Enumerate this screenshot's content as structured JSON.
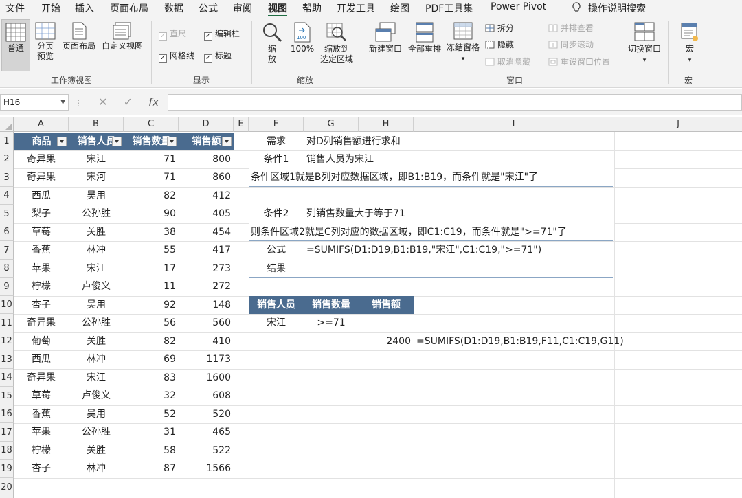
{
  "menu": [
    "文件",
    "开始",
    "插入",
    "页面布局",
    "数据",
    "公式",
    "审阅",
    "视图",
    "帮助",
    "开发工具",
    "绘图",
    "PDF工具集",
    "Power Pivot",
    "操作说明搜索"
  ],
  "ribbon": {
    "workbook_views": {
      "normal": "普通",
      "page_break_1": "分页",
      "page_break_2": "预览",
      "page_layout": "页面布局",
      "custom_views": "自定义视图",
      "group_label": "工作簿视图"
    },
    "show": {
      "ruler": "直尺",
      "formula_bar": "编辑栏",
      "gridlines": "网格线",
      "headings": "标题",
      "group_label": "显示"
    },
    "zoom": {
      "zoom_1": "缩",
      "zoom_2": "放",
      "zoom_100": "100%",
      "zoom_sel_1": "缩放到",
      "zoom_sel_2": "选定区域",
      "group_label": "缩放"
    },
    "window": {
      "new_window": "新建窗口",
      "arrange_all": "全部重排",
      "freeze_panes": "冻结窗格",
      "split": "拆分",
      "hide": "隐藏",
      "unhide": "取消隐藏",
      "side_by_side": "并排查看",
      "sync_scroll": "同步滚动",
      "reset_position": "重设窗口位置",
      "switch_windows": "切换窗口",
      "group_label": "窗口"
    },
    "macros": {
      "macros": "宏",
      "group_label": "宏"
    }
  },
  "formula_bar": {
    "name_box": "H16",
    "cancel": "✕",
    "enter": "✓",
    "fx": "fx",
    "content": ""
  },
  "columns": [
    "A",
    "B",
    "C",
    "D",
    "E",
    "F",
    "G",
    "H",
    "I",
    "J"
  ],
  "rows": [
    "1",
    "2",
    "3",
    "4",
    "5",
    "6",
    "7",
    "8",
    "9",
    "10",
    "11",
    "12",
    "13",
    "14",
    "15",
    "16",
    "17",
    "18",
    "19",
    "20"
  ],
  "table": {
    "headers": [
      "商品",
      "销售人员",
      "销售数量",
      "销售额"
    ],
    "rows": [
      [
        "奇异果",
        "宋江",
        "71",
        "800"
      ],
      [
        "奇异果",
        "宋河",
        "71",
        "860"
      ],
      [
        "西瓜",
        "吴用",
        "82",
        "412"
      ],
      [
        "梨子",
        "公孙胜",
        "90",
        "405"
      ],
      [
        "草莓",
        "关胜",
        "38",
        "454"
      ],
      [
        "香蕉",
        "林冲",
        "55",
        "417"
      ],
      [
        "苹果",
        "宋江",
        "17",
        "273"
      ],
      [
        "柠檬",
        "卢俊义",
        "11",
        "272"
      ],
      [
        "杏子",
        "吴用",
        "92",
        "148"
      ],
      [
        "奇异果",
        "公孙胜",
        "56",
        "560"
      ],
      [
        "葡萄",
        "关胜",
        "82",
        "410"
      ],
      [
        "西瓜",
        "林冲",
        "69",
        "1173"
      ],
      [
        "奇异果",
        "宋江",
        "83",
        "1600"
      ],
      [
        "草莓",
        "卢俊义",
        "32",
        "608"
      ],
      [
        "香蕉",
        "吴用",
        "52",
        "520"
      ],
      [
        "苹果",
        "公孙胜",
        "31",
        "465"
      ],
      [
        "柠檬",
        "关胜",
        "58",
        "522"
      ],
      [
        "杏子",
        "林冲",
        "87",
        "1566"
      ]
    ]
  },
  "notes": {
    "need_label": "需求",
    "need_text": "对D列销售额进行求和",
    "cond1_label": "条件1",
    "cond1_text": "销售人员为宋江",
    "cond1_explain": "条件区域1就是B列对应数据区域，即B1:B19，而条件就是\"宋江\"了",
    "cond2_label": "条件2",
    "cond2_text": "列销售数量大于等于71",
    "cond2_explain": "则条件区域2就是C列对应的数据区域，即C1:C19，而条件就是\">=71\"了",
    "formula_label": "公式",
    "formula_text": "=SUMIFS(D1:D19,B1:B19,\"宋江\",C1:C19,\">=71\")",
    "result_label": "结果"
  },
  "criteria": {
    "headers": [
      "销售人员",
      "销售数量",
      "销售额"
    ],
    "person": "宋江",
    "qty": ">=71",
    "result": "2400",
    "formula": "=SUMIFS(D1:D19,B1:B19,F11,C1:C19,G11)"
  }
}
